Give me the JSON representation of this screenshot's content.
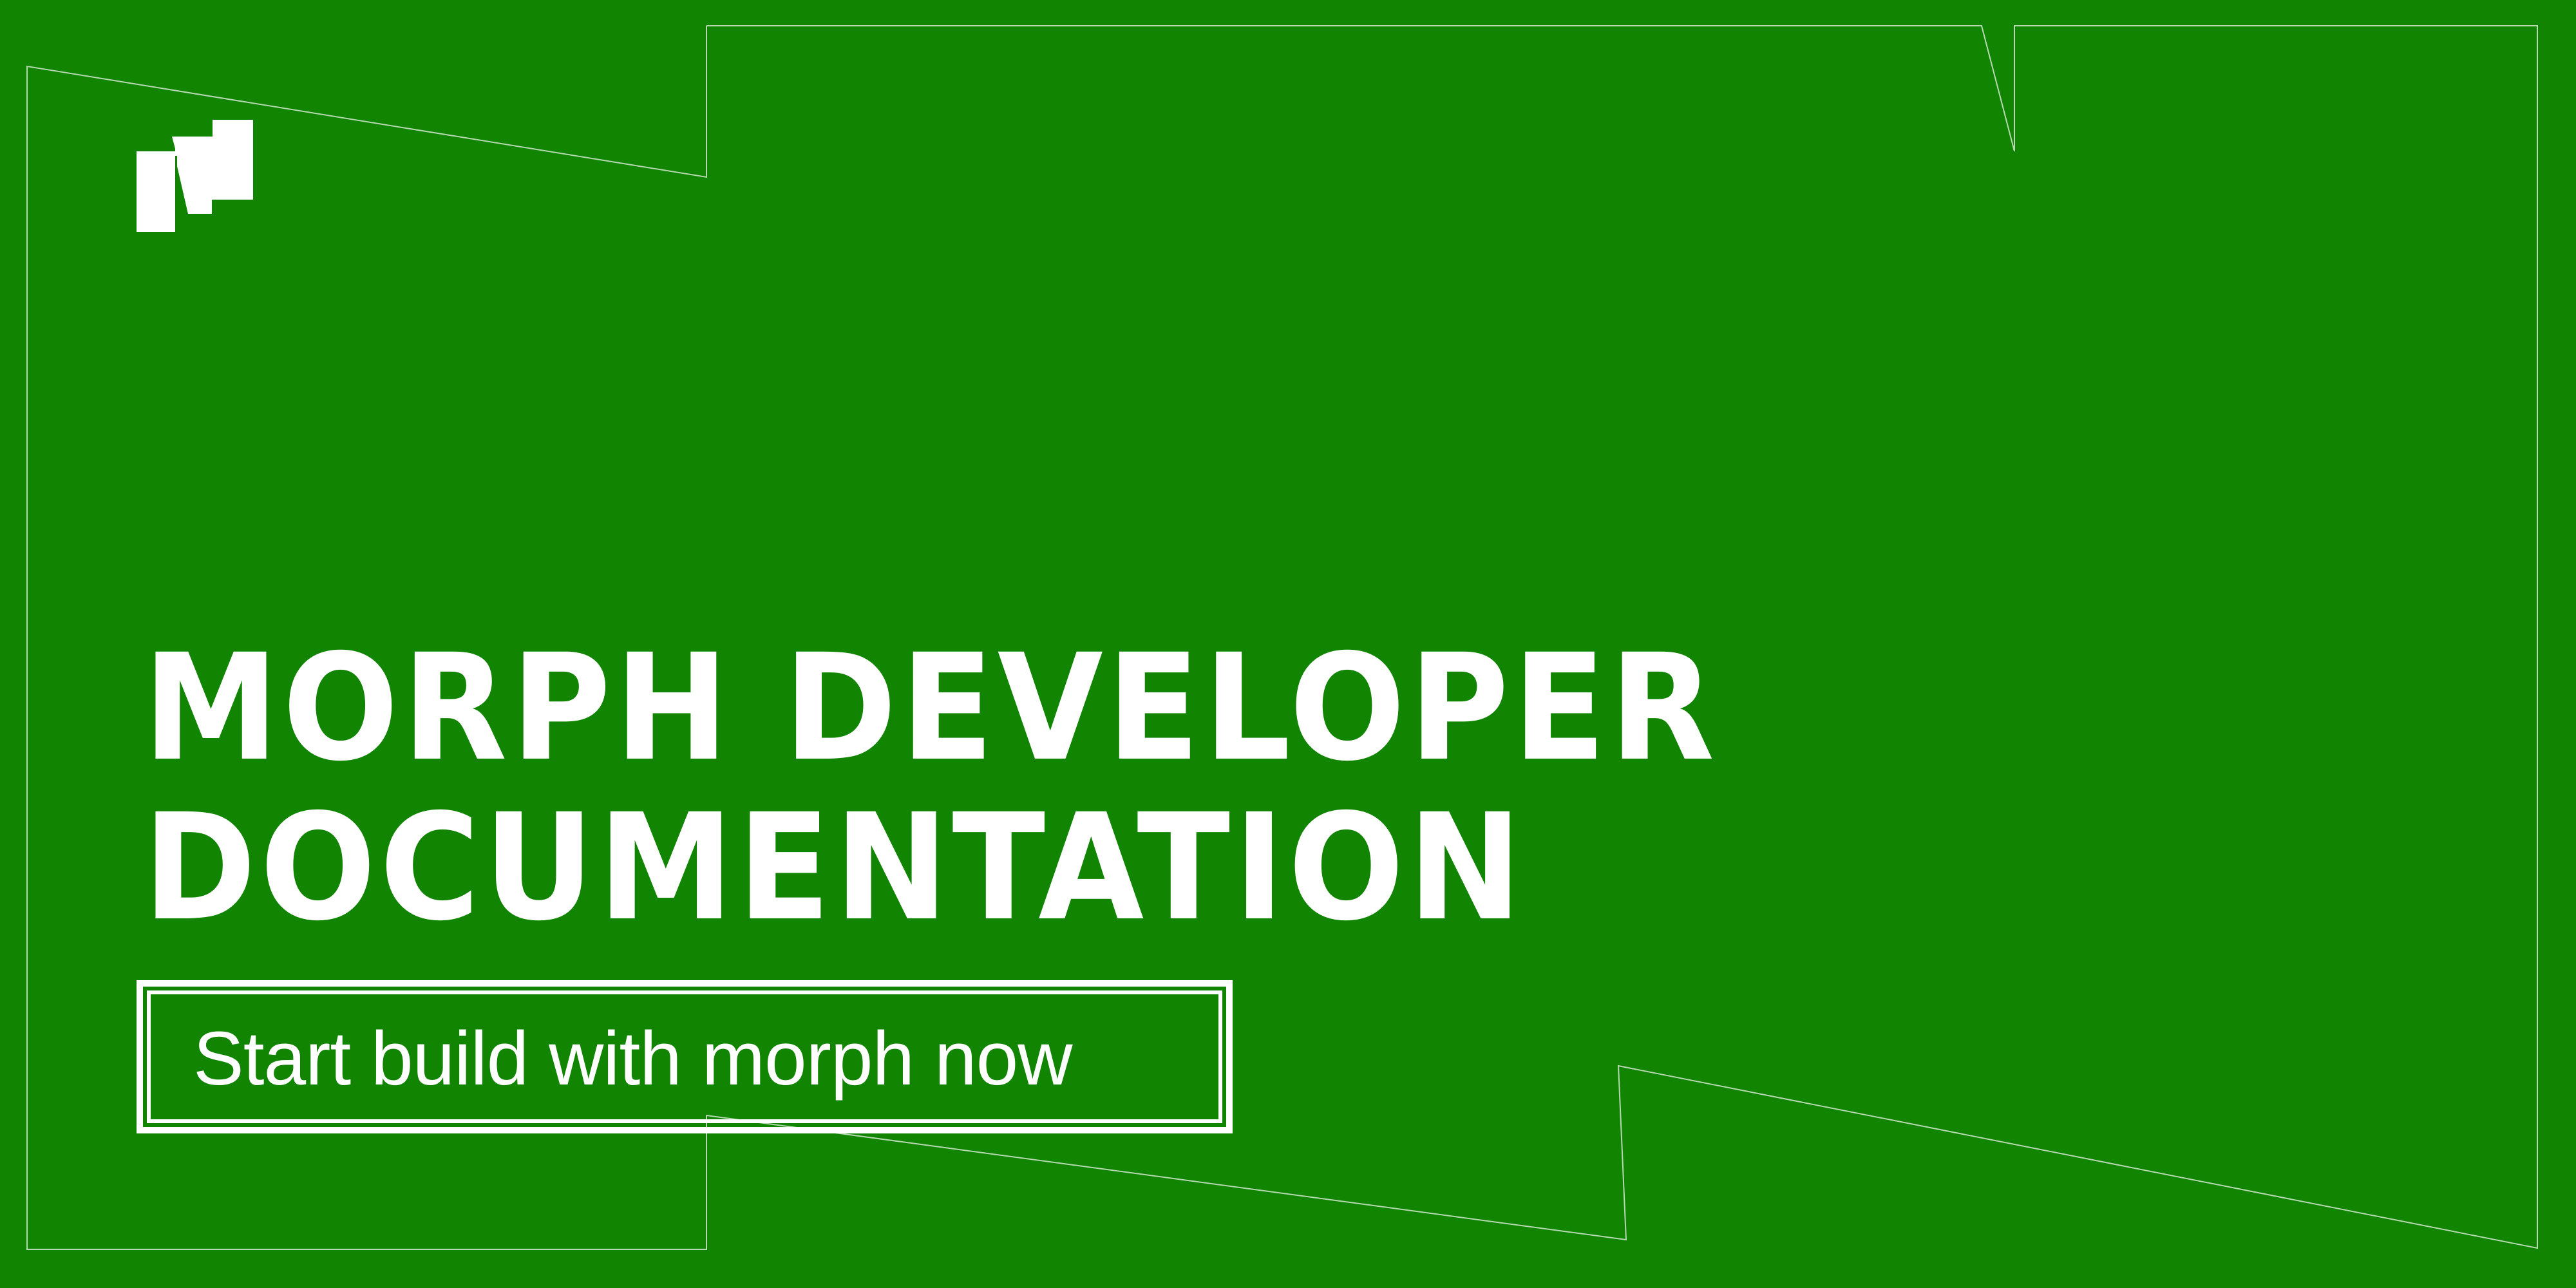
{
  "brand": {
    "logo_icon": "morph-logo-icon",
    "colors": {
      "background": "#118402",
      "foreground": "#ffffff",
      "outline": "#b6d9b1"
    }
  },
  "hero": {
    "title_line1": "MORPH DEVELOPER",
    "title_line2": "DOCUMENTATION"
  },
  "cta": {
    "label": "Start build with morph now"
  }
}
